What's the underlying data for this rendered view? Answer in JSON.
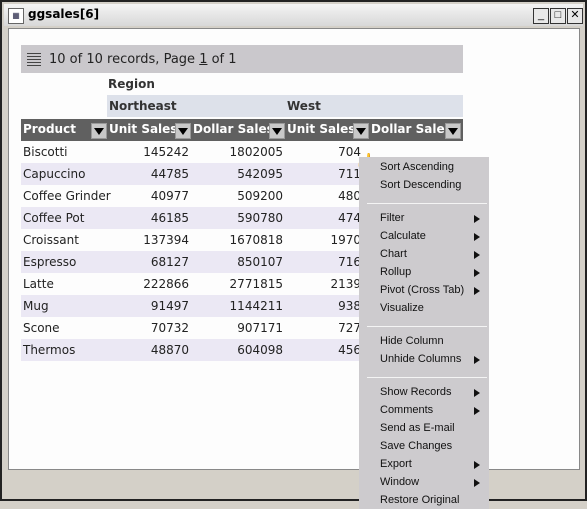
{
  "window": {
    "title": "ggsales[6]",
    "icon": "report-icon",
    "controls": [
      "minimize",
      "maximize",
      "close"
    ]
  },
  "records_bar": {
    "prefix": "10 of 10 records, Page ",
    "page": "1",
    "suffix": " of 1"
  },
  "table": {
    "region_label": "Region",
    "regions": [
      "Northeast",
      "West"
    ],
    "columns": [
      "Product",
      "Unit Sales",
      "Dollar Sales",
      "Unit Sales",
      "Dollar Sales"
    ],
    "rows": [
      [
        "Biscotti",
        "145242",
        "1802005",
        "704"
      ],
      [
        "Capuccino",
        "44785",
        "542095",
        "711"
      ],
      [
        "Coffee Grinder",
        "40977",
        "509200",
        "480"
      ],
      [
        "Coffee Pot",
        "46185",
        "590780",
        "474"
      ],
      [
        "Croissant",
        "137394",
        "1670818",
        "1970"
      ],
      [
        "Espresso",
        "68127",
        "850107",
        "716"
      ],
      [
        "Latte",
        "222866",
        "2771815",
        "2139"
      ],
      [
        "Mug",
        "91497",
        "1144211",
        "938"
      ],
      [
        "Scone",
        "70732",
        "907171",
        "727"
      ],
      [
        "Thermos",
        "48870",
        "604098",
        "456"
      ]
    ]
  },
  "menu": {
    "items": [
      {
        "label": "Sort Ascending",
        "submenu": false
      },
      {
        "label": "Sort Descending",
        "submenu": false
      },
      {
        "sep": true
      },
      {
        "label": "Filter",
        "submenu": true
      },
      {
        "label": "Calculate",
        "submenu": true
      },
      {
        "label": "Chart",
        "submenu": true
      },
      {
        "label": "Rollup",
        "submenu": true
      },
      {
        "label": "Pivot (Cross Tab)",
        "submenu": true
      },
      {
        "label": "Visualize",
        "submenu": false
      },
      {
        "sep": true
      },
      {
        "label": "Hide Column",
        "submenu": false
      },
      {
        "label": "Unhide Columns",
        "submenu": true
      },
      {
        "sep": true
      },
      {
        "label": "Show Records",
        "submenu": true
      },
      {
        "label": "Comments",
        "submenu": true
      },
      {
        "label": "Send as E-mail",
        "submenu": false
      },
      {
        "label": "Save Changes",
        "submenu": false
      },
      {
        "label": "Export",
        "submenu": true
      },
      {
        "label": "Window",
        "submenu": true
      },
      {
        "label": "Restore Original",
        "submenu": false
      }
    ]
  }
}
